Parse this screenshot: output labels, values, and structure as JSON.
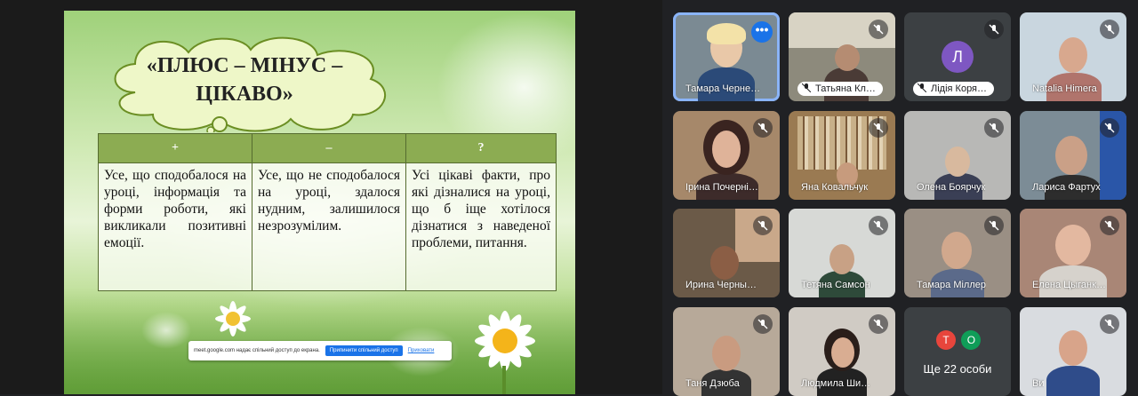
{
  "slide": {
    "title": "«ПЛЮС – МІНУС – ЦІКАВО»",
    "table": {
      "headers": [
        "+",
        "–",
        "?"
      ],
      "cells": [
        "Усе, що сподобалося на уроці, інформація та форми роботи, які викликали позитивні емоції.",
        "Усе, що не сподобалося на уроці, здалося нудним, залишилося незрозумілим.",
        "Усі цікаві факти, про які дізналися на уроці, що б іще хотілося дізнатися з наведеної проблеми, питання."
      ]
    }
  },
  "share_bar": {
    "message": "meet.google.com надає спільний доступ до екрана.",
    "stop_label": "Припинити спільний доступ",
    "hide_label": "Приховати"
  },
  "participants": [
    {
      "name": "Тамара Черне…",
      "active": true,
      "more_icon": "more-horiz-icon"
    },
    {
      "name": "Татьяна Кл…",
      "muted": true
    },
    {
      "name": "Лідія Коря…",
      "muted": true,
      "avatar_letter": "Л",
      "avatar_color": "#7e57c2"
    },
    {
      "name": "Natalia Himera",
      "muted": true
    },
    {
      "name": "Ірина Почерні…",
      "muted": true
    },
    {
      "name": "Яна Ковальчук",
      "muted": true
    },
    {
      "name": "Олена Боярчук",
      "muted": true
    },
    {
      "name": "Лариса Фартух",
      "muted": true
    },
    {
      "name": "Ирина Черны…",
      "muted": true
    },
    {
      "name": "Тетяна Самсон",
      "muted": true
    },
    {
      "name": "Тамара Міллер",
      "muted": true
    },
    {
      "name": "Елена Цыганк…",
      "muted": true
    },
    {
      "name": "Таня Дзюба",
      "muted": true
    },
    {
      "name": "Людмила Ши…",
      "muted": true
    },
    {
      "name": "Ще 22 особи",
      "avatars": [
        "Т",
        "О"
      ]
    },
    {
      "name": "Ви",
      "muted": true
    }
  ]
}
